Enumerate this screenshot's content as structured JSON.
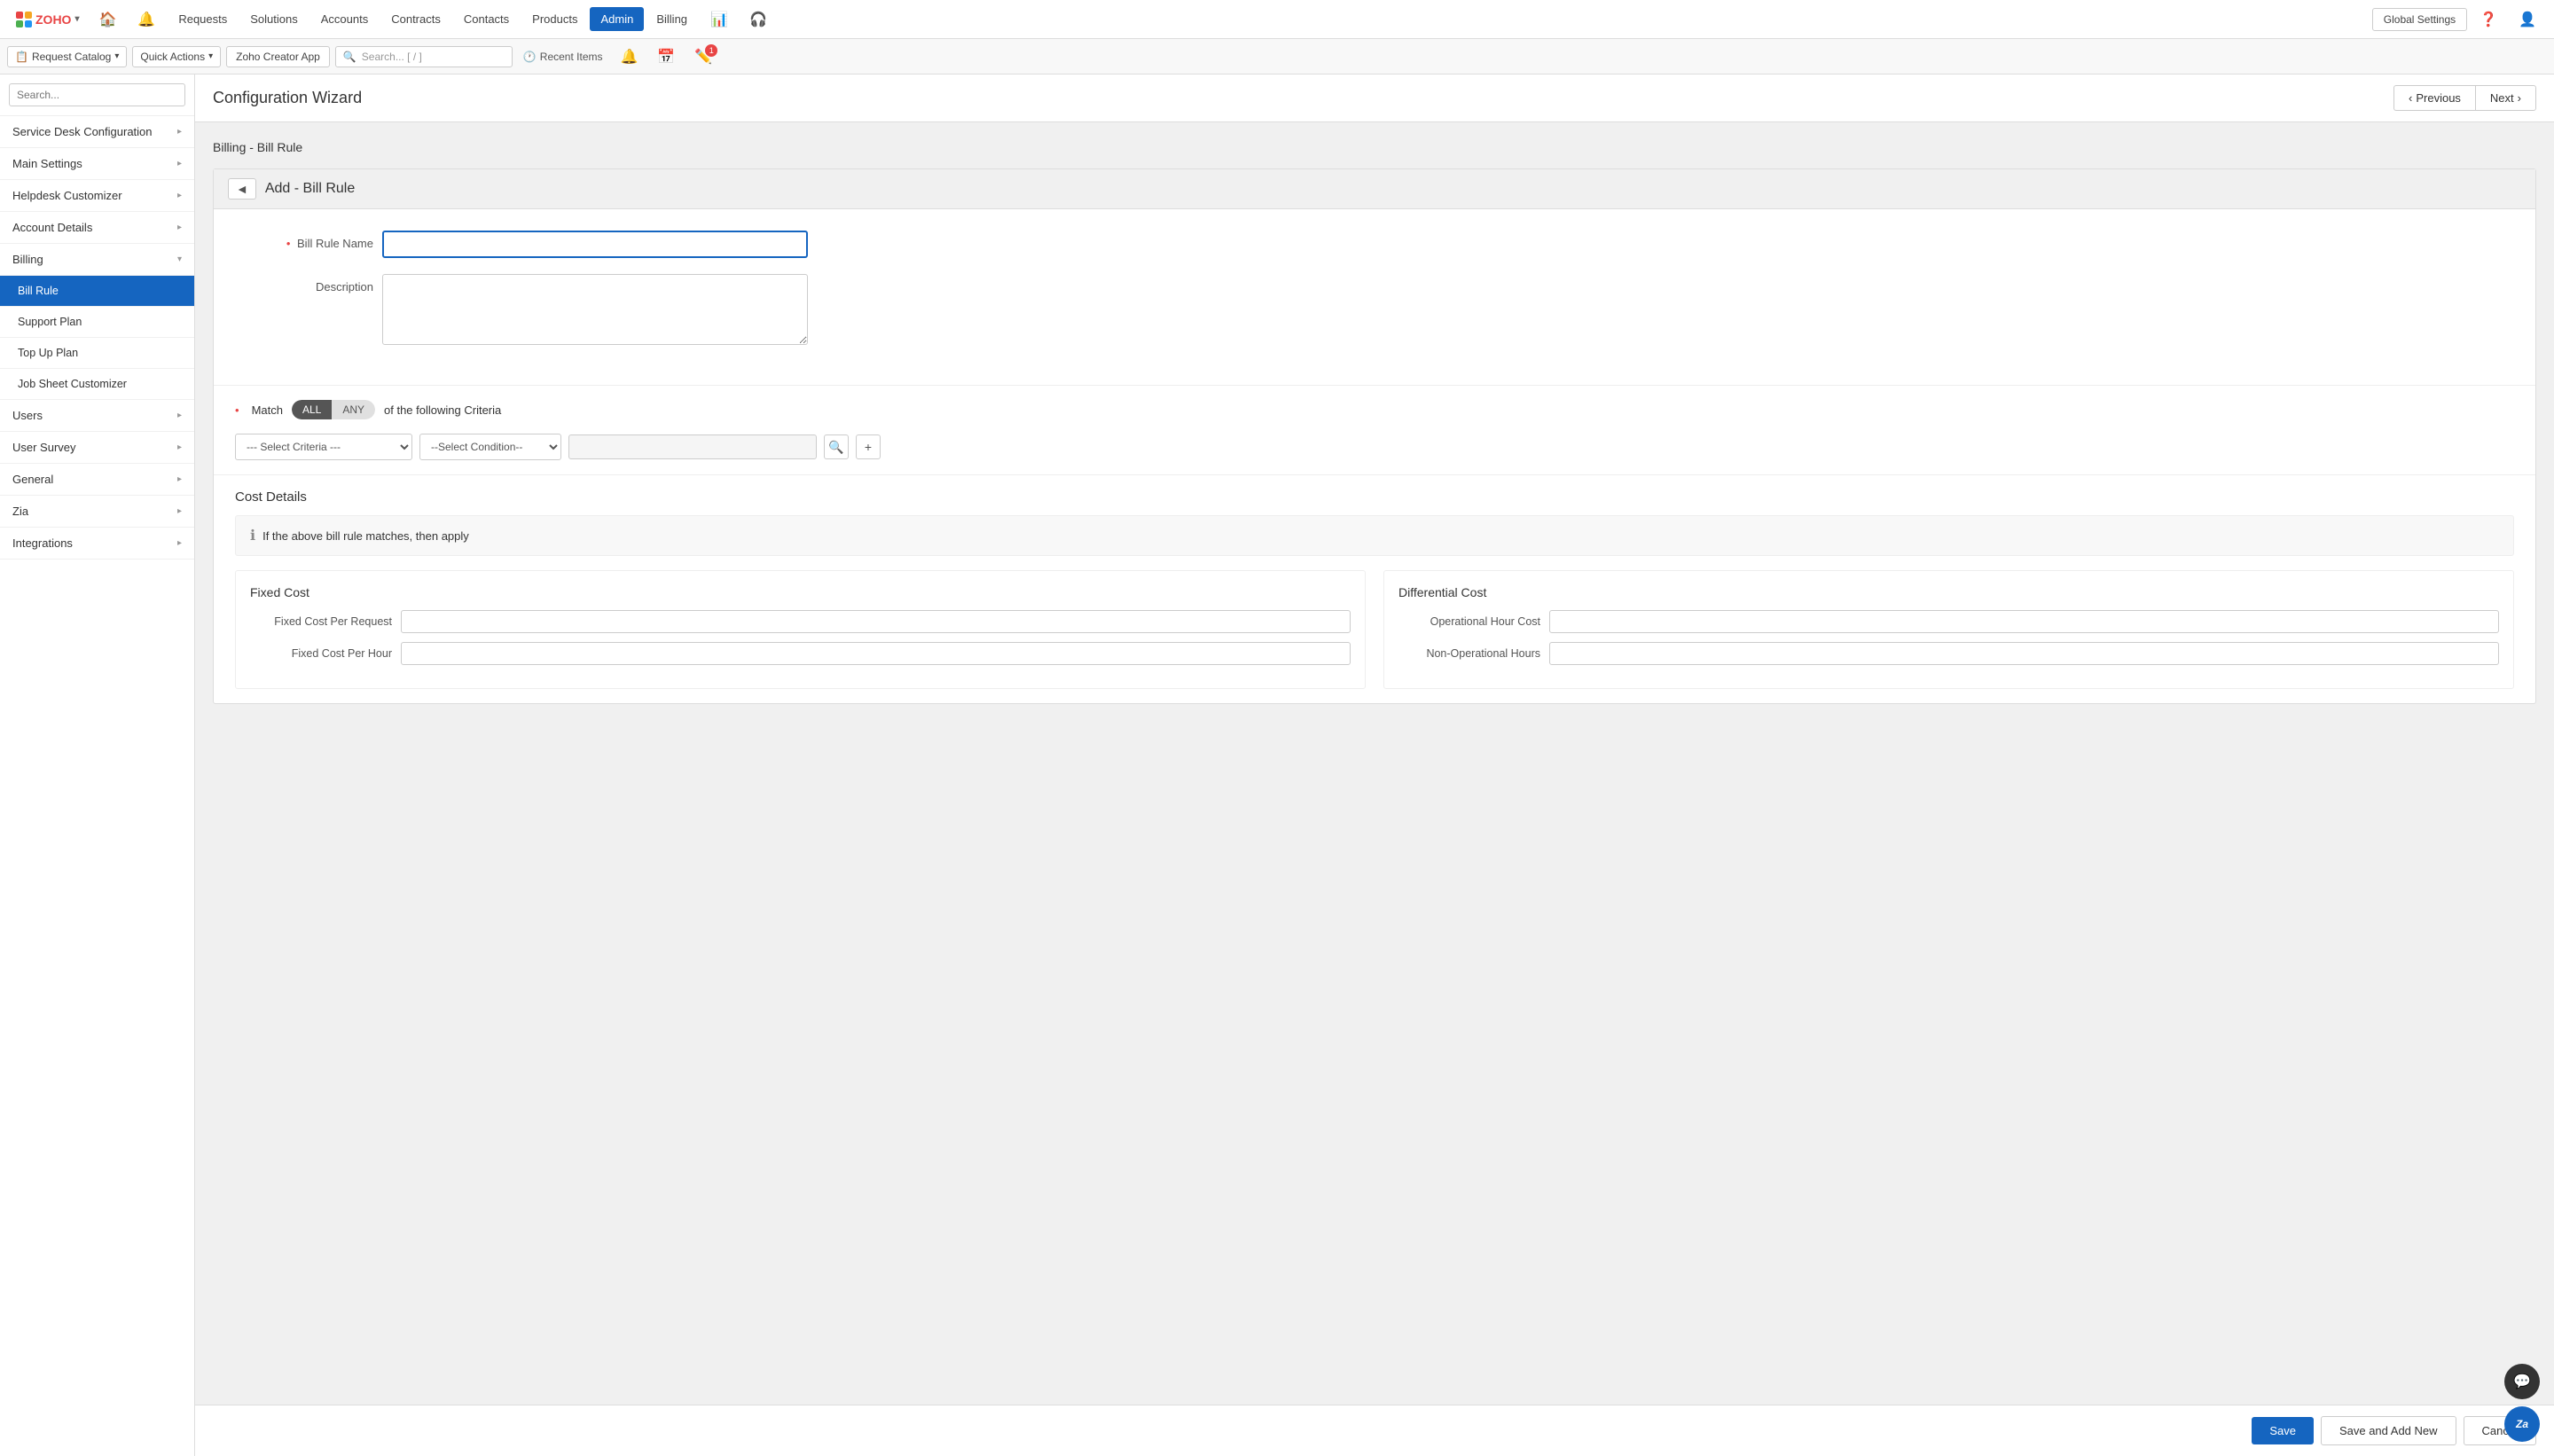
{
  "app": {
    "logo_text": "ZOHO",
    "nav_items": [
      "Requests",
      "Solutions",
      "Accounts",
      "Contracts",
      "Contacts",
      "Products",
      "Admin",
      "Billing"
    ],
    "active_nav": "Admin",
    "global_settings_label": "Global Settings"
  },
  "second_nav": {
    "catalog_label": "Request Catalog",
    "quick_actions_label": "Quick Actions",
    "zoho_creator_label": "Zoho Creator App",
    "search_placeholder": "Search... [ / ]",
    "recent_items_label": "Recent Items"
  },
  "sidebar": {
    "search_placeholder": "Search...",
    "items": [
      {
        "label": "Service Desk Configuration",
        "has_arrow": true,
        "expanded": false
      },
      {
        "label": "Main Settings",
        "has_arrow": true,
        "expanded": false
      },
      {
        "label": "Helpdesk Customizer",
        "has_arrow": true,
        "expanded": false
      },
      {
        "label": "Account Details",
        "has_arrow": true,
        "expanded": false
      },
      {
        "label": "Billing",
        "has_arrow": true,
        "expanded": true
      },
      {
        "label": "Bill Rule",
        "has_arrow": false,
        "active": true
      },
      {
        "label": "Support Plan",
        "has_arrow": false
      },
      {
        "label": "Top Up Plan",
        "has_arrow": false
      },
      {
        "label": "Job Sheet Customizer",
        "has_arrow": false
      },
      {
        "label": "Users",
        "has_arrow": true,
        "expanded": false
      },
      {
        "label": "User Survey",
        "has_arrow": true,
        "expanded": false
      },
      {
        "label": "General",
        "has_arrow": true,
        "expanded": false
      },
      {
        "label": "Zia",
        "has_arrow": true,
        "expanded": false
      },
      {
        "label": "Integrations",
        "has_arrow": true,
        "expanded": false
      }
    ]
  },
  "wizard": {
    "title": "Configuration Wizard",
    "prev_label": "Previous",
    "next_label": "Next"
  },
  "form": {
    "breadcrumb": "Billing  -  Bill Rule",
    "card_title": "Add - Bill Rule",
    "bill_rule_name_label": "Bill Rule Name",
    "description_label": "Description",
    "match_label": "Match",
    "all_label": "ALL",
    "any_label": "ANY",
    "of_following_label": "of the following Criteria",
    "criteria_placeholder": "--- Select Criteria ---",
    "condition_placeholder": "--Select Condition--",
    "cost_details_title": "Cost Details",
    "cost_info_text": "If the above bill rule matches, then apply",
    "fixed_cost_title": "Fixed Cost",
    "fixed_cost_per_request_label": "Fixed Cost Per Request",
    "fixed_cost_per_hour_label": "Fixed Cost Per Hour",
    "differential_cost_title": "Differential Cost",
    "operational_hour_cost_label": "Operational Hour Cost",
    "non_operational_hours_label": "Non-Operational Hours"
  },
  "actions": {
    "save_label": "Save",
    "save_add_label": "Save and Add New",
    "cancel_label": "Cancel"
  }
}
